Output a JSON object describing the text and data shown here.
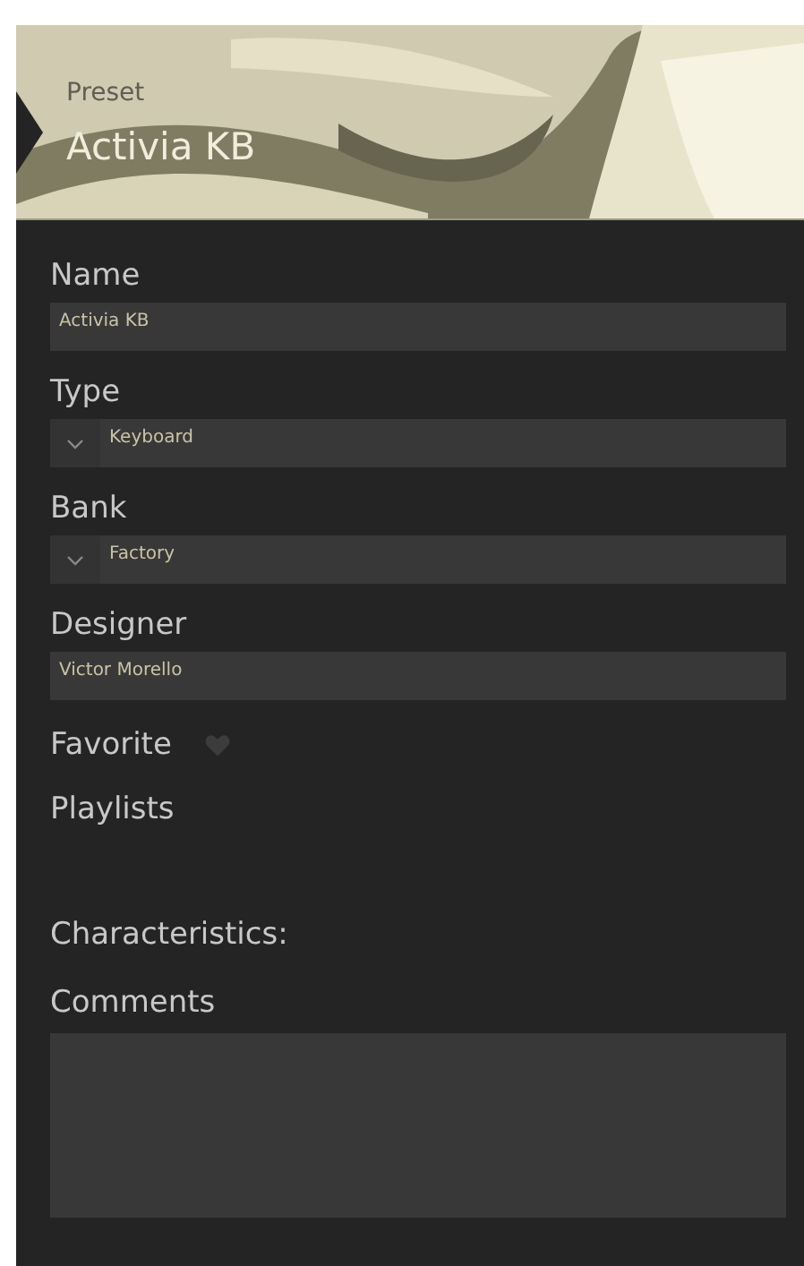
{
  "header": {
    "caption": "Preset",
    "title": "Activia KB",
    "kind": "picture"
  },
  "fields": [
    {
      "label": "Name",
      "kind": "text",
      "value": "Activia KB"
    },
    {
      "label": "Type",
      "kind": "dropdown",
      "value": "Keyboard"
    },
    {
      "label": "Bank",
      "kind": "dropdown",
      "value": "Factory"
    },
    {
      "label": "Designer",
      "kind": "text",
      "value": "Victor Morello"
    }
  ],
  "favorite": {
    "label": "Favorite",
    "on": false
  },
  "playlists": {
    "label": "Playlists"
  },
  "characteristics": {
    "label": "Characteristics:"
  },
  "comments": {
    "label": "Comments"
  }
}
